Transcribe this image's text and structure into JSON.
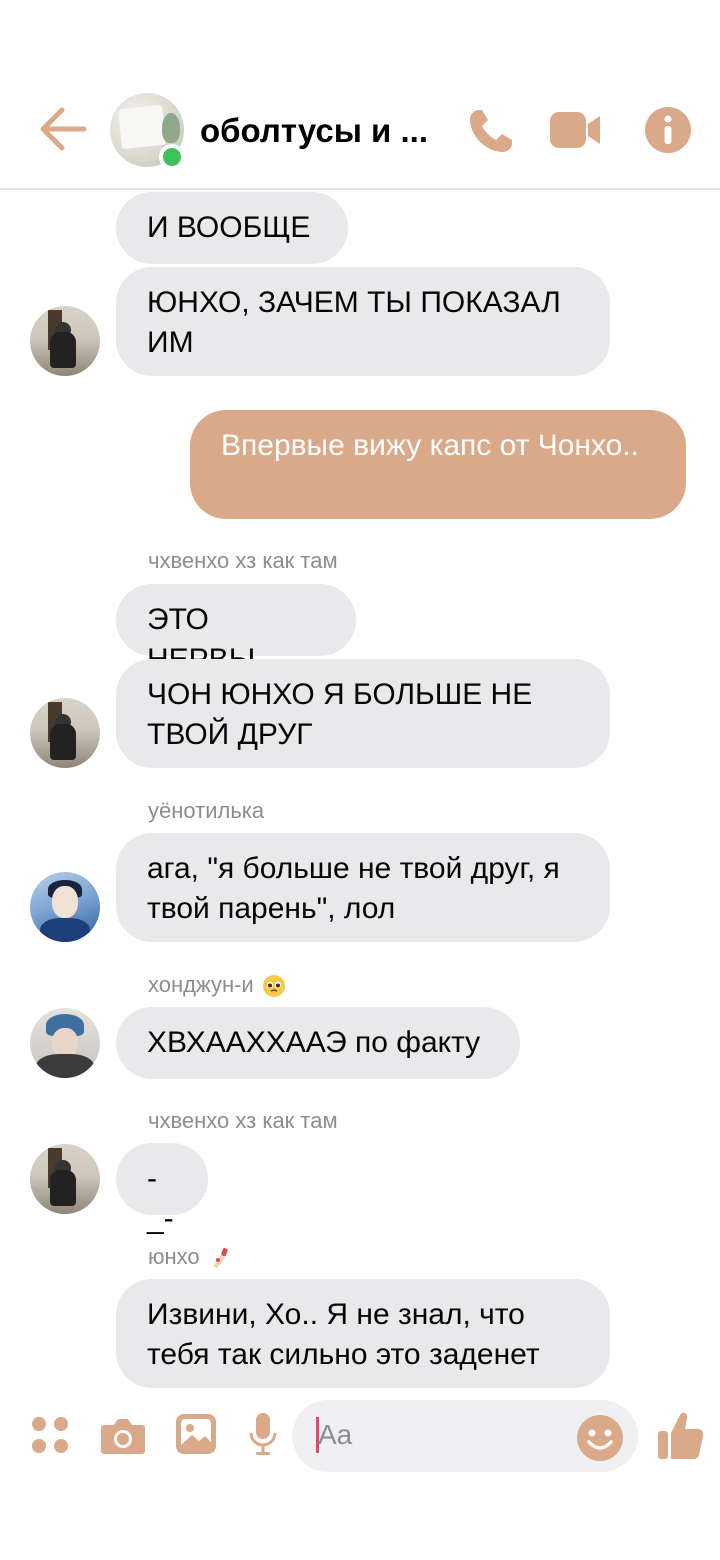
{
  "header": {
    "title": "оболтусы и ...",
    "accent_color": "#d9a98a",
    "online_color": "#3ec15a"
  },
  "messages": [
    {
      "type": "bubble",
      "direction": "in",
      "text": "И ВООБЩЕ"
    },
    {
      "type": "bubble",
      "direction": "in",
      "text": "ЮНХО, ЗАЧЕМ ТЫ ПОКАЗАЛ ИМ"
    },
    {
      "type": "bubble",
      "direction": "out",
      "text": "Впервые вижу капс от Чонхо.."
    },
    {
      "type": "sender",
      "text": "чхвенхо хз как там"
    },
    {
      "type": "bubble",
      "direction": "in",
      "text": "ЭТО НЕРВЫ"
    },
    {
      "type": "bubble",
      "direction": "in",
      "text": "ЧОН ЮНХО Я БОЛЬШЕ НЕ ТВОЙ ДРУГ"
    },
    {
      "type": "sender",
      "text": "уёнотилька"
    },
    {
      "type": "bubble",
      "direction": "in",
      "text": "ага, \"я больше не твой друг, я твой парень\", лол"
    },
    {
      "type": "sender",
      "text": "хонджун-и",
      "emoji": "pleading-face-emoji"
    },
    {
      "type": "bubble",
      "direction": "in",
      "text": "ХВХААХХААЭ по факту"
    },
    {
      "type": "sender",
      "text": "чхвенхо хз как там"
    },
    {
      "type": "bubble",
      "direction": "in",
      "text": "-_-"
    },
    {
      "type": "sender",
      "text": "юнхо",
      "emoji": "nail-polish-emoji"
    },
    {
      "type": "bubble",
      "direction": "in",
      "text": "Извини, Хо.. Я не знал, что тебя так сильно это заденет"
    }
  ],
  "composer": {
    "placeholder": "Aa",
    "icons": [
      "menu-grid-icon",
      "camera-icon",
      "gallery-icon",
      "microphone-icon",
      "emoji-icon",
      "thumbs-up-icon"
    ]
  }
}
